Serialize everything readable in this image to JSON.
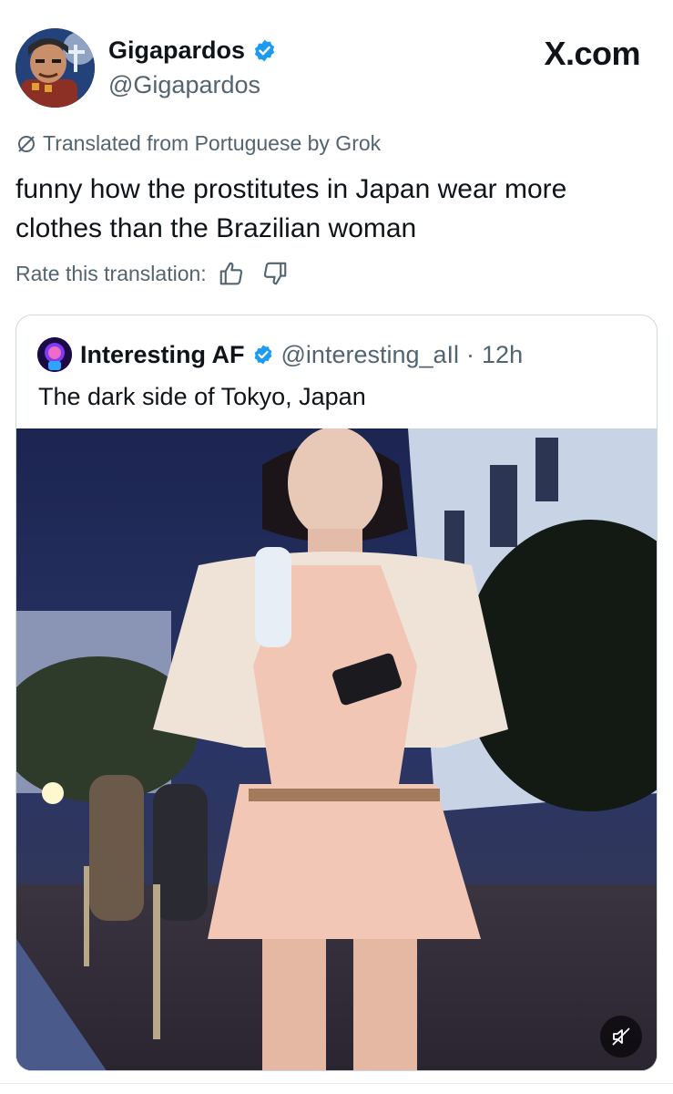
{
  "author": {
    "display_name": "Gigapardos",
    "handle": "@Gigapardos",
    "avatar_icon": "cartoon-character-avatar",
    "verified_icon": "verified-badge-icon"
  },
  "site_logo": "X.com",
  "translation": {
    "notice": "Translated from Portuguese by Grok",
    "rate_label": "Rate this translation:",
    "thumbs_up_icon": "thumbs-up-icon",
    "thumbs_down_icon": "thumbs-down-icon"
  },
  "tweet": {
    "text": "funny how the prostitutes in Japan wear more clothes than the Brazilian woman"
  },
  "quoted_tweet": {
    "display_name": "Interesting AF",
    "handle": "@interesting_aIl",
    "separator": "·",
    "time": "12h",
    "text": "The dark side of Tokyo, Japan",
    "media_type": "video",
    "mute_icon": "speaker-muted-icon"
  },
  "colors": {
    "text_primary": "#0f1419",
    "text_secondary": "#536471",
    "verified_blue": "#1d9bf0",
    "border": "#cfd9de"
  }
}
